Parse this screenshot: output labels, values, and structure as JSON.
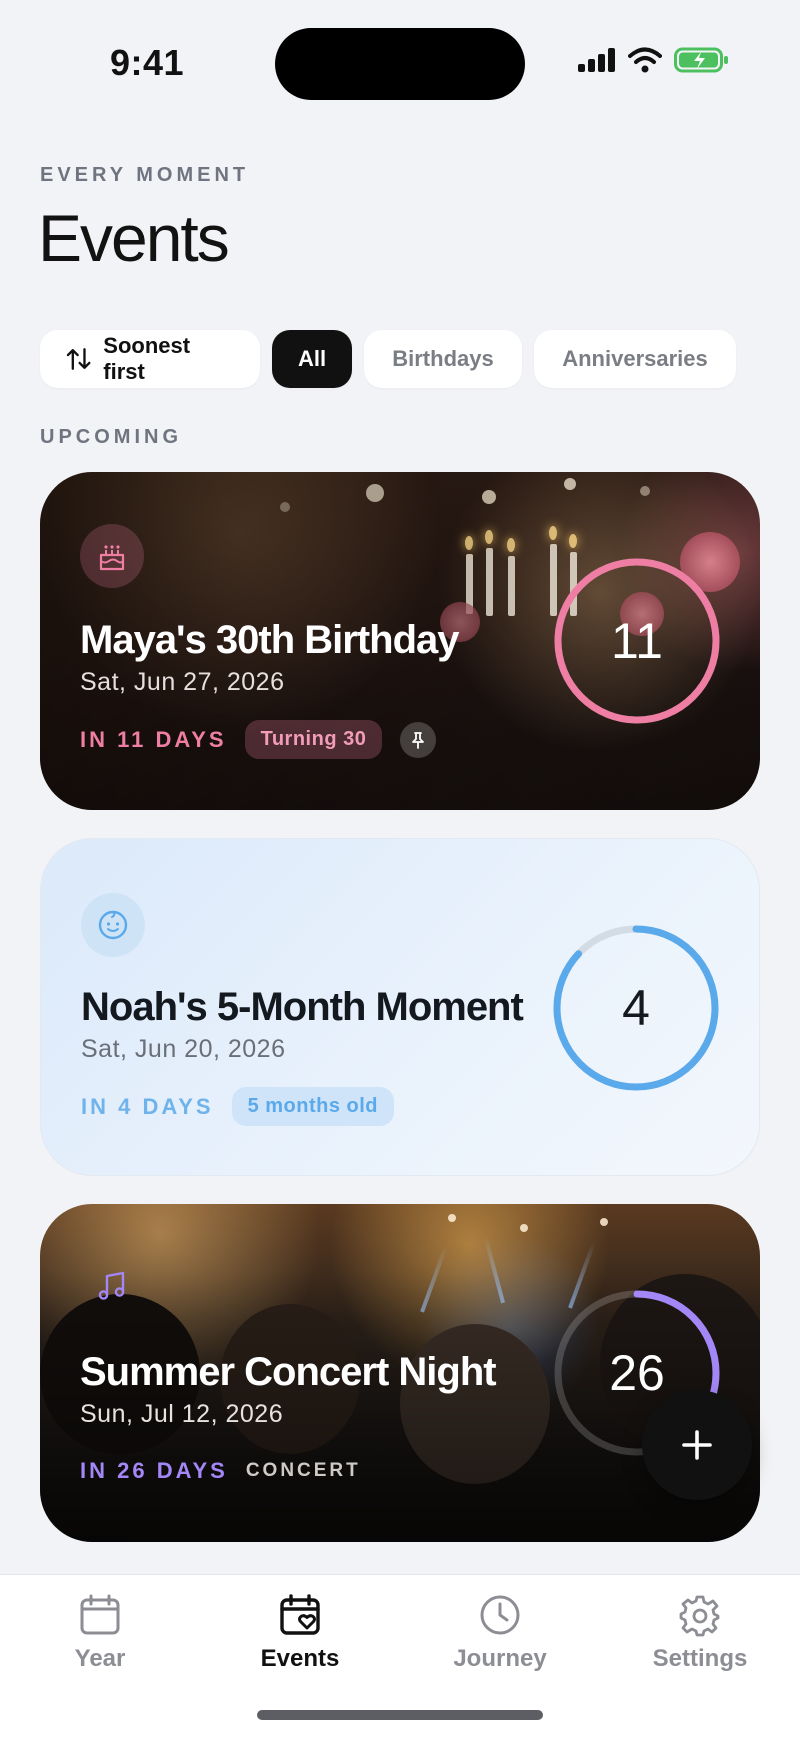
{
  "status_bar": {
    "time": "9:41"
  },
  "header": {
    "eyebrow": "EVERY MOMENT",
    "title": "Events"
  },
  "filters": {
    "sort_label": "Soonest first",
    "chips": [
      "All",
      "Birthdays",
      "Anniversaries"
    ],
    "active": "All"
  },
  "section": {
    "label": "UPCOMING"
  },
  "events": [
    {
      "title": "Maya's 30th Birthday",
      "date": "Sat, Jun 27, 2026",
      "countdown": "IN 11 DAYS",
      "tag": "Turning 30",
      "days": "11",
      "icon": "cake-icon",
      "pinned": true,
      "accent": "#ee7ea3",
      "ring_progress": 1.0
    },
    {
      "title": "Noah's 5-Month Moment",
      "date": "Sat, Jun 20, 2026",
      "countdown": "IN 4 DAYS",
      "tag": "5 months old",
      "days": "4",
      "icon": "baby-face-icon",
      "accent": "#5aa9ea",
      "ring_progress": 0.87
    },
    {
      "title": "Summer Concert Night",
      "date": "Sun, Jul 12, 2026",
      "countdown": "IN 26 DAYS",
      "tag": "CONCERT",
      "days": "26",
      "icon": "music-note-icon",
      "accent": "#a487f7",
      "ring_progress": 0.3
    }
  ],
  "tabbar": {
    "items": [
      {
        "label": "Year",
        "icon": "calendar-icon"
      },
      {
        "label": "Events",
        "icon": "calendar-heart-icon"
      },
      {
        "label": "Journey",
        "icon": "clock-icon"
      },
      {
        "label": "Settings",
        "icon": "gear-icon"
      }
    ],
    "active": "Events"
  }
}
